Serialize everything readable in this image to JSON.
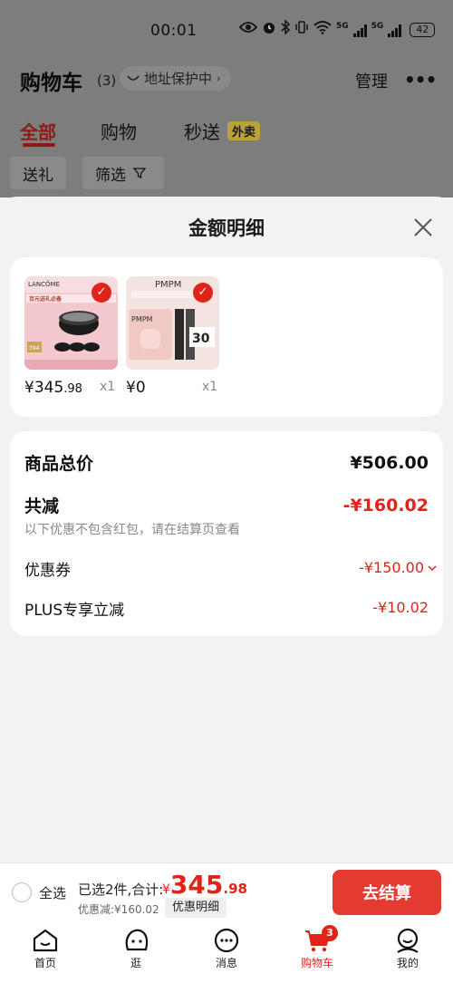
{
  "status_bar": {
    "time": "00:01",
    "net1": "5G",
    "net2": "5G",
    "battery": "42"
  },
  "header": {
    "title": "购物车",
    "count": "(3)",
    "address_label": "地址保护中",
    "manage_label": "管理",
    "more_label": "•••"
  },
  "tabs": [
    {
      "label": "全部",
      "active": true
    },
    {
      "label": "购物"
    },
    {
      "label": "秒送",
      "badge": "外卖"
    }
  ],
  "filters": {
    "gift_label": "送礼",
    "filter_label": "筛选"
  },
  "sheet": {
    "title": "金额明细",
    "products": [
      {
        "brand": "LANCÔME",
        "image_text1": "百元送礼必备",
        "image_text2": "394",
        "price_int": "¥345",
        "price_dec": ".98",
        "qty": "x1"
      },
      {
        "brand": "PMPM",
        "image_text1": "PMPM",
        "image_text2": "30",
        "price_int": "¥0",
        "price_dec": "",
        "qty": "x1"
      }
    ],
    "summary": {
      "total_label": "商品总价",
      "total_value": "¥506.00",
      "reduce_label": "共减",
      "reduce_value": "-¥160.02",
      "note": "以下优惠不包含红包，请在结算页查看",
      "coupon_label": "优惠券",
      "coupon_value": "-¥150.00",
      "plus_label": "PLUS专享立减",
      "plus_value": "-¥10.02"
    }
  },
  "bottom_bar": {
    "select_all": "全选",
    "selected_text": "已选2件,合计:",
    "total_currency": "¥",
    "total_int": "345",
    "total_dec": ".98",
    "discount_text": "优惠减:¥160.02",
    "detail_button": "优惠明细",
    "checkout_button": "去结算"
  },
  "nav": {
    "items": [
      {
        "label": "首页",
        "icon": "home-icon"
      },
      {
        "label": "逛",
        "icon": "browse-icon"
      },
      {
        "label": "消息",
        "icon": "message-icon"
      },
      {
        "label": "购物车",
        "icon": "cart-icon",
        "active": true,
        "badge": "3"
      },
      {
        "label": "我的",
        "icon": "profile-icon"
      }
    ]
  },
  "colors": {
    "accent": "#e2231a",
    "checkout": "#e53a32",
    "overlay": "#7d7d7d"
  }
}
